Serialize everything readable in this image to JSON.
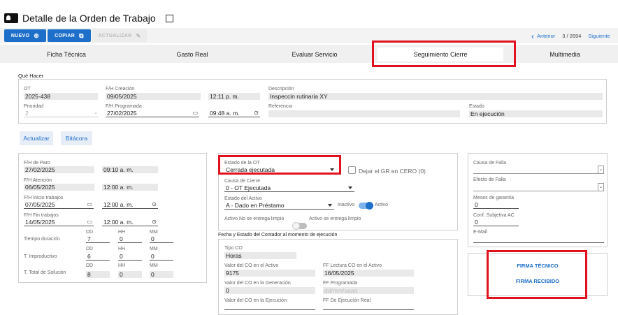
{
  "header": {
    "title": "Detalle de la Orden de Trabajo"
  },
  "toolbar": {
    "nuevo": "NUEVO",
    "copiar": "COPIAR",
    "actualizar": "ACTUALIZAR"
  },
  "nav": {
    "anterior": "Anterior",
    "position": "3 / 2694",
    "siguiente": "Siguiente"
  },
  "tabs": [
    "Ficha Técnica",
    "Gasto Real",
    "Evaluar Servicio",
    "Seguimiento Cierre",
    "Multimedia"
  ],
  "active_tab": "Seguimiento Cierre",
  "que_hacer": {
    "section_label": "Qué Hacer",
    "ot_label": "OT",
    "ot": "2025-438",
    "fh_creacion_label": "F/H Creación",
    "fh_creacion_date": "09/05/2025",
    "fh_creacion_time": "12:11 p. m.",
    "descripcion_label": "Descripción",
    "descripcion": "Inspeccin rutinaria XY",
    "prioridad_label": "Prioridad",
    "prioridad": "2",
    "fh_programada_label": "F/H Programada",
    "fh_programada_date": "27/02/2025",
    "fh_programada_time": "09:48 a. m.",
    "referencia_label": "Referencia",
    "referencia": "",
    "estado_label": "Estado",
    "estado": "En ejecución"
  },
  "buttons": {
    "actualizar": "Actualizar",
    "bitacora": "Bitácora"
  },
  "left": {
    "paro_label": "F/H de Paro",
    "paro_date": "27/02/2025",
    "paro_time": "09:10 a. m.",
    "atencion_label": "F/H Atención",
    "atencion_date": "06/05/2025",
    "atencion_time": "12:00 a. m.",
    "inicio_label": "F/H Inicio trabajos",
    "inicio_date": "07/05/2025",
    "inicio_time": "12:00 a. m.",
    "fin_label": "F/H Fin trabajos",
    "fin_date": "14/05/2025",
    "fin_time": "12:00 a. m.",
    "dd": "DD",
    "hh": "HH",
    "mm": "MM",
    "rows": [
      {
        "label": "Tiempo duración",
        "dd": "7",
        "hh": "0",
        "mm": "0"
      },
      {
        "label": "T. Improductivo",
        "dd": "6",
        "hh": "0",
        "mm": "0"
      },
      {
        "label": "T. Total de Solución",
        "dd": "8",
        "hh": "0",
        "mm": "0"
      }
    ]
  },
  "middle": {
    "estado_ot_label": "Estado de la OT",
    "estado_ot": "Cerrada ejecutada",
    "dejar_gr": "Dejar el GR en CERO (0)",
    "causa_cierre_label": "Causa de Cierre",
    "causa_cierre": "0 - OT Ejecutada",
    "estado_activo_label": "Estado del Activo",
    "estado_activo": "A - Dado en Préstamo",
    "inactivo": "Inactivo",
    "activo": "Activo",
    "activo_no_entrega": "Activo No se entrega limpio",
    "activo_si_entrega": "Activo se entrega limpio",
    "contador_title": "Fecha y Estado del Contador al momento de ejecución",
    "tipo_co_label": "Tipo CO",
    "tipo_co": "Horas",
    "valor_activo_label": "Valor del CO en el Activo",
    "valor_activo": "9175",
    "ff_lectura_label": "FF Lectura CO en el Activo",
    "ff_lectura": "16/05/2025",
    "valor_generacion_label": "Valor del CO en la Generación",
    "valor_generacion": "0",
    "ff_programada_label": "FF Programada",
    "ff_programada": "dd/mm/aaaa",
    "valor_ejecucion_label": "Valor del CO en la Ejecución",
    "ff_ejecucion_label": "FF De Ejecución Real"
  },
  "right": {
    "causa_falla_label": "Causa de Falla",
    "efecto_falla_label": "Efecto de Falla",
    "meses_garantia_label": "Meses de garantía",
    "meses_garantia": "0",
    "conf_subjetiva_label": "Conf. Subjetiva AC",
    "conf_subjetiva": "0",
    "email_label": "E-Mail",
    "firma_tecnico": "FIRMA TÉCNICO",
    "firma_recibido": "FIRMA RECIBIDO"
  },
  "colors": {
    "primary": "#1e6fc9",
    "highlight": "#e1121d",
    "toggle_on": "#7fb2ea"
  }
}
